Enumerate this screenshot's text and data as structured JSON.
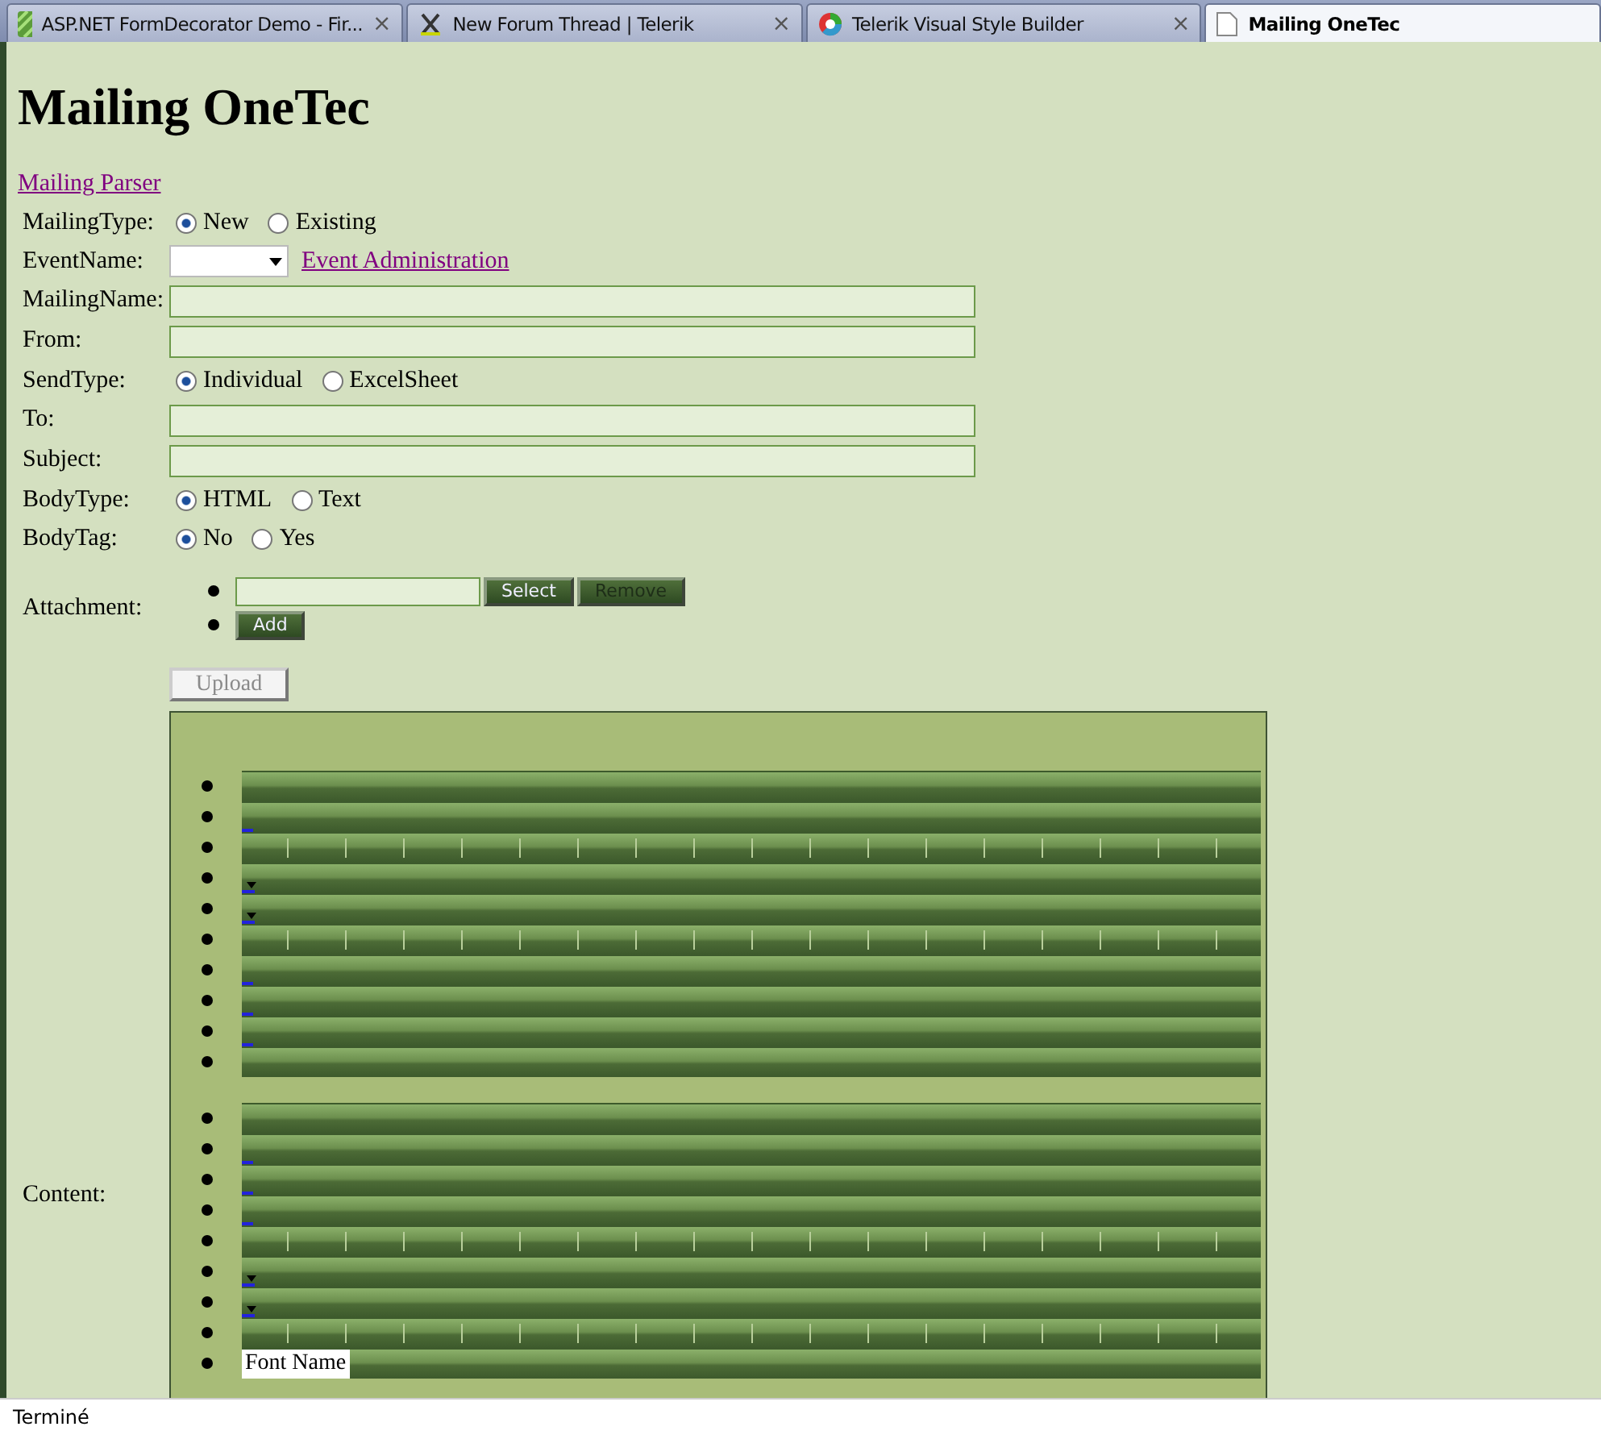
{
  "tabs": [
    {
      "label": "ASP.NET FormDecorator Demo - Fir...",
      "close": "×",
      "selected": false
    },
    {
      "label": "New Forum Thread | Telerik",
      "close": "×",
      "selected": false
    },
    {
      "label": "Telerik Visual Style Builder",
      "close": "×",
      "selected": false
    },
    {
      "label": "Mailing OneTec",
      "selected": true
    }
  ],
  "heading": "Mailing OneTec",
  "parser_link": "Mailing Parser",
  "form": [
    {
      "kind": "radio",
      "label": "MailingType:",
      "options": [
        {
          "label": "New",
          "selected": true
        },
        {
          "label": "Existing",
          "selected": false
        }
      ]
    },
    {
      "kind": "select",
      "label": "EventName:",
      "link": "Event Administration"
    },
    {
      "kind": "text",
      "label": "MailingName:"
    },
    {
      "kind": "text",
      "label": "From:"
    },
    {
      "kind": "radio",
      "label": "SendType:",
      "options": [
        {
          "label": "Individual",
          "selected": true
        },
        {
          "label": "ExcelSheet",
          "selected": false
        }
      ]
    },
    {
      "kind": "text",
      "label": "To:"
    },
    {
      "kind": "text",
      "label": "Subject:"
    },
    {
      "kind": "radio",
      "label": "BodyType:",
      "options": [
        {
          "label": "HTML",
          "selected": true
        },
        {
          "label": "Text",
          "selected": false
        }
      ]
    },
    {
      "kind": "radio",
      "label": "BodyTag:",
      "options": [
        {
          "label": "No",
          "selected": true
        },
        {
          "label": "Yes",
          "selected": false
        }
      ]
    },
    {
      "kind": "attachment",
      "label": "Attachment:",
      "select": "Select",
      "remove": "Remove",
      "add": "Add"
    },
    {
      "kind": "upload",
      "button": "Upload"
    },
    {
      "kind": "editor",
      "label": "Content:",
      "toolbars": [
        [
          {
            "kind": "plain"
          },
          {
            "kind": "link"
          },
          {
            "kind": "split"
          },
          {
            "kind": "dropdown"
          },
          {
            "kind": "dropdown"
          },
          {
            "kind": "split"
          },
          {
            "kind": "link"
          },
          {
            "kind": "link"
          },
          {
            "kind": "link"
          },
          {
            "kind": "plain"
          }
        ],
        [
          {
            "kind": "plain"
          },
          {
            "kind": "link"
          },
          {
            "kind": "link"
          },
          {
            "kind": "link"
          },
          {
            "kind": "split"
          },
          {
            "kind": "dropdown"
          },
          {
            "kind": "dropdown"
          },
          {
            "kind": "split"
          },
          {
            "kind": "font",
            "text": "Font Name"
          }
        ]
      ]
    }
  ],
  "status": "Terminé"
}
